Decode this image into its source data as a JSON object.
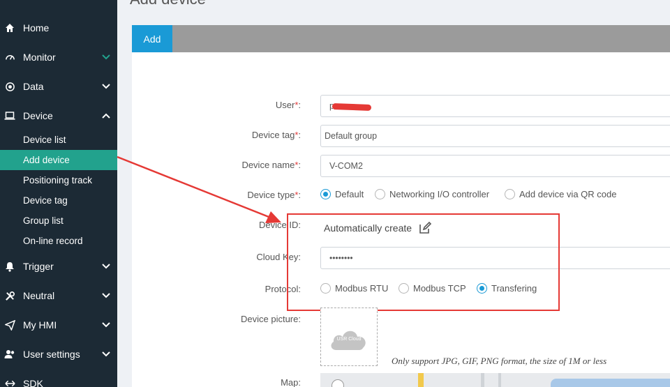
{
  "page": {
    "title": "Add device"
  },
  "sidebar": {
    "items": [
      {
        "label": "Home",
        "icon": "home-icon"
      },
      {
        "label": "Monitor",
        "icon": "gauge-icon"
      },
      {
        "label": "Data",
        "icon": "target-icon"
      },
      {
        "label": "Device",
        "icon": "laptop-icon"
      },
      {
        "label": "Trigger",
        "icon": "bell-icon"
      },
      {
        "label": "Neutral",
        "icon": "tools-icon"
      },
      {
        "label": "My HMI",
        "icon": "send-icon"
      },
      {
        "label": "User settings",
        "icon": "users-icon"
      },
      {
        "label": "SDK",
        "icon": "arrows-icon"
      }
    ],
    "device_sub": [
      {
        "label": "Device list"
      },
      {
        "label": "Add device"
      },
      {
        "label": "Positioning track"
      },
      {
        "label": "Device tag"
      },
      {
        "label": "Group list"
      },
      {
        "label": "On-line record"
      }
    ]
  },
  "tabs": {
    "add": "Add"
  },
  "form": {
    "user": {
      "label": "User",
      "value": "p"
    },
    "device_tag": {
      "label": "Device tag",
      "value": "Default group"
    },
    "device_name": {
      "label": "Device name",
      "value": "V-COM2"
    },
    "device_type": {
      "label": "Device type",
      "options": [
        "Default",
        "Networking I/O controller",
        "Add device via QR code"
      ],
      "selected": "Default"
    },
    "device_id": {
      "label": "Device ID",
      "value": "Automatically create"
    },
    "cloud_key": {
      "label": "Cloud Key",
      "value": "••••••••"
    },
    "protocol": {
      "label": "Protocol",
      "options": [
        "Modbus RTU",
        "Modbus TCP",
        "Transfering"
      ],
      "selected": "Transfering"
    },
    "device_picture": {
      "label": "Device picture",
      "logo_text": "USR Cloud",
      "hint": "Only support JPG, GIF, PNG format, the size of 1M or less"
    },
    "map": {
      "label": "Map"
    }
  },
  "colors": {
    "sidebar_bg": "#1c2a35",
    "active": "#22a28d",
    "accent": "#1a9ad6",
    "annotation": "#e53935"
  }
}
